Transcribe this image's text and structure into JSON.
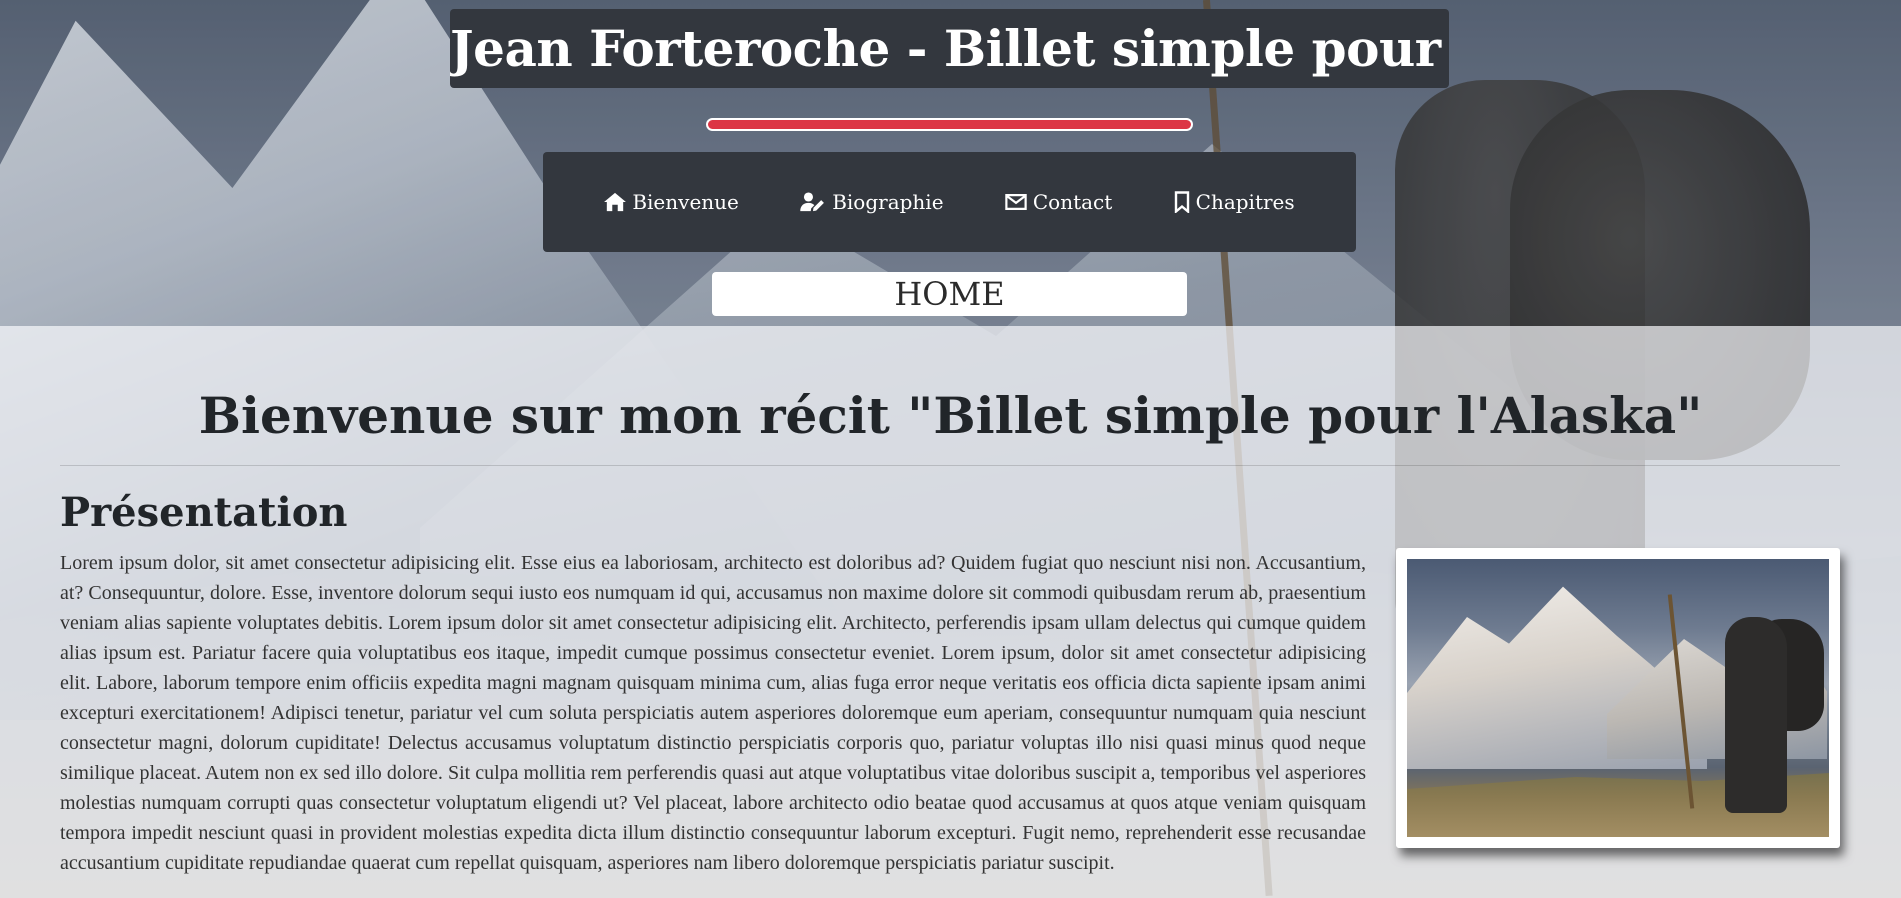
{
  "header": {
    "site_title": "Jean Forteroche - Billet simple pour l'Alaska",
    "page_label": "HOME",
    "accent_color": "#dc3545"
  },
  "nav": {
    "items": [
      {
        "label": "Bienvenue",
        "icon": "home-icon"
      },
      {
        "label": "Biographie",
        "icon": "user-edit-icon"
      },
      {
        "label": "Contact",
        "icon": "envelope-icon"
      },
      {
        "label": "Chapitres",
        "icon": "bookmark-icon"
      }
    ]
  },
  "main": {
    "welcome_heading": "Bienvenue sur mon récit \"Billet simple pour l'Alaska\"",
    "section_title": "Présentation",
    "paragraph": "Lorem ipsum dolor, sit amet consectetur adipisicing elit. Esse eius ea laboriosam, architecto est doloribus ad? Quidem fugiat quo nesciunt nisi non. Accusantium, at? Consequuntur, dolore. Esse, inventore dolorum sequi iusto eos numquam id qui, accusamus non maxime dolore sit commodi quibusdam rerum ab, praesentium veniam alias sapiente voluptates debitis. Lorem ipsum dolor sit amet consectetur adipisicing elit. Architecto, perferendis ipsam ullam delectus qui cumque quidem alias ipsum est. Pariatur facere quia voluptatibus eos itaque, impedit cumque possimus consectetur eveniet. Lorem ipsum, dolor sit amet consectetur adipisicing elit. Labore, laborum tempore enim officiis expedita magni magnam quisquam minima cum, alias fuga error neque veritatis eos officia dicta sapiente ipsam animi excepturi exercitationem! Adipisci tenetur, pariatur vel cum soluta perspiciatis autem asperiores doloremque eum aperiam, consequuntur numquam quia nesciunt consectetur magni, dolorum cupiditate! Delectus accusamus voluptatum distinctio perspiciatis corporis quo, pariatur voluptas illo nisi quasi minus quod neque similique placeat. Autem non ex sed illo dolore. Sit culpa mollitia rem perferendis quasi aut atque voluptatibus vitae doloribus suscipit a, temporibus vel asperiores molestias numquam corrupti quas consectetur voluptatum eligendi ut? Vel placeat, labore architecto odio beatae quod accusamus at quos atque veniam quisquam tempora impedit nesciunt quasi in provident molestias expedita dicta illum distinctio consequuntur laborum excepturi. Fugit nemo, reprehenderit esse recusandae accusantium cupiditate repudiandae quaerat cum repellat quisquam, asperiores nam libero doloremque perspiciatis pariatur suscipit."
  }
}
